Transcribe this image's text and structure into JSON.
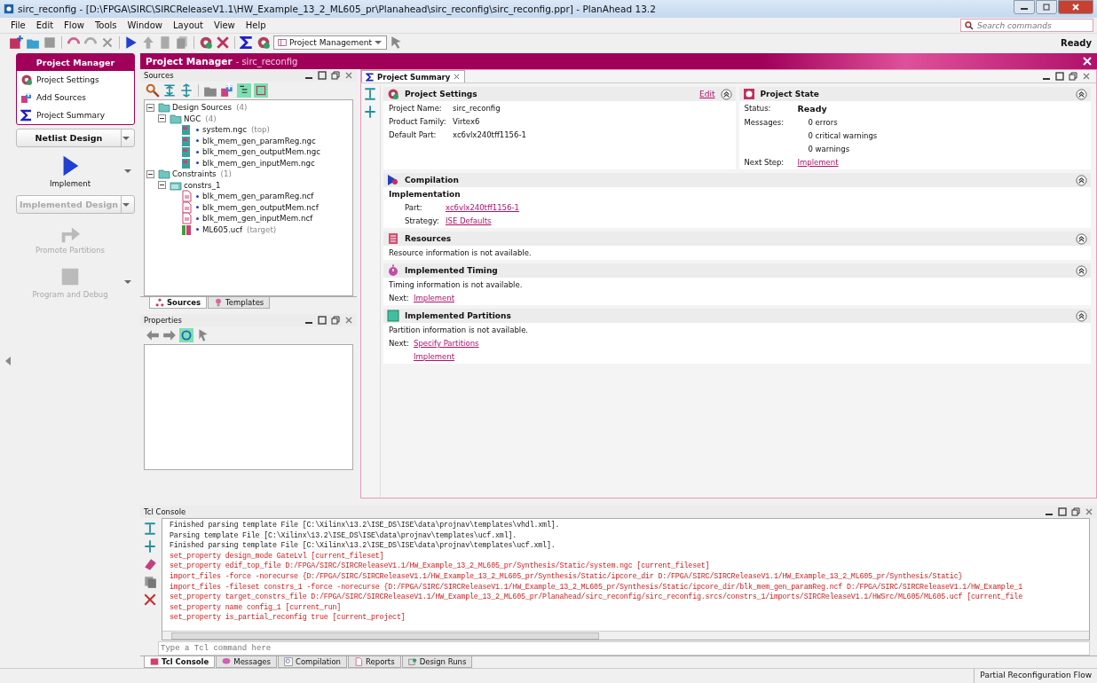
{
  "window": {
    "title": "sirc_reconfig - [D:\\FPGA\\SIRC\\SIRCReleaseV1.1\\HW_Example_13_2_ML605_pr\\Planahead\\sirc_reconfig\\sirc_reconfig.ppr] - PlanAhead  13.2"
  },
  "menu": [
    "File",
    "Edit",
    "Flow",
    "Tools",
    "Window",
    "Layout",
    "View",
    "Help"
  ],
  "search": {
    "placeholder": "Search commands"
  },
  "toolbar": {
    "perspective": "Project Management",
    "status": "Ready"
  },
  "flow_navigator": {
    "header": "Project Manager",
    "items": [
      {
        "label": "Project Settings",
        "kind": "settings"
      },
      {
        "label": "Add Sources",
        "kind": "add"
      },
      {
        "label": "Project Summary",
        "kind": "sigma"
      }
    ],
    "steps": [
      {
        "kind": "dropdown",
        "label": "Netlist Design",
        "disabled": false
      },
      {
        "kind": "action",
        "label": "Implement",
        "disabled": false,
        "menu": true
      },
      {
        "kind": "dropdown",
        "label": "Implemented Design",
        "disabled": true
      },
      {
        "kind": "action",
        "label": "Promote Partitions",
        "disabled": true
      },
      {
        "kind": "action",
        "label": "Program and Debug",
        "disabled": true,
        "menu": true
      }
    ]
  },
  "banner": {
    "title": "Project Manager",
    "subtitle": "- sirc_reconfig"
  },
  "sources": {
    "title": "Sources",
    "tree": [
      {
        "label": "Design Sources",
        "note": "(4)",
        "kind": "folder",
        "expanded": true,
        "children": [
          {
            "label": "NGC",
            "note": "(4)",
            "kind": "folder",
            "expanded": true,
            "children": [
              {
                "label": "system.ngc",
                "note": "(top)",
                "kind": "ngc"
              },
              {
                "label": "blk_mem_gen_paramReg.ngc",
                "kind": "ngc"
              },
              {
                "label": "blk_mem_gen_outputMem.ngc",
                "kind": "ngc"
              },
              {
                "label": "blk_mem_gen_inputMem.ngc",
                "kind": "ngc"
              }
            ]
          }
        ]
      },
      {
        "label": "Constraints",
        "note": "(1)",
        "kind": "folder",
        "expanded": true,
        "children": [
          {
            "label": "constrs_1",
            "kind": "fileset",
            "expanded": true,
            "children": [
              {
                "label": "blk_mem_gen_paramReg.ncf",
                "kind": "ncf"
              },
              {
                "label": "blk_mem_gen_outputMem.ncf",
                "kind": "ncf"
              },
              {
                "label": "blk_mem_gen_inputMem.ncf",
                "kind": "ncf"
              },
              {
                "label": "ML605.ucf",
                "note": "(target)",
                "kind": "ucf"
              }
            ]
          }
        ]
      }
    ],
    "tabs": [
      {
        "label": "Sources",
        "selected": true
      },
      {
        "label": "Templates",
        "selected": false
      }
    ]
  },
  "properties": {
    "title": "Properties"
  },
  "summary": {
    "tab": "Project Summary",
    "settings": {
      "title": "Project Settings",
      "edit": "Edit",
      "rows": [
        {
          "label": "Project Name:",
          "value": "sirc_reconfig"
        },
        {
          "label": "Product Family:",
          "value": "Virtex6"
        },
        {
          "label": "Default Part:",
          "value": "xc6vlx240tff1156-1"
        }
      ]
    },
    "state": {
      "title": "Project State",
      "status_label": "Status:",
      "status": "Ready",
      "messages_label": "Messages:",
      "messages": [
        "0 errors",
        "0 critical warnings",
        "0 warnings"
      ],
      "next_label": "Next Step:",
      "next": "Implement"
    },
    "sections": [
      {
        "title": "Compilation",
        "kind": "compilation",
        "heading": "Implementation",
        "rows": [
          {
            "label": "Part:",
            "links": [
              "xc6vlx240tff1156-1"
            ]
          },
          {
            "label": "Strategy:",
            "links": [
              "ISE Defaults"
            ]
          }
        ]
      },
      {
        "title": "Resources",
        "kind": "resources",
        "text": "Resource information is not available."
      },
      {
        "title": "Implemented Timing",
        "kind": "timing",
        "text": "Timing information is not available.",
        "rows": [
          {
            "label": "Next:",
            "links": [
              "Implement"
            ]
          }
        ]
      },
      {
        "title": "Implemented Partitions",
        "kind": "partitions",
        "text": "Partition information is not available.",
        "rows": [
          {
            "label": "Next:",
            "links": [
              "Specify Partitions",
              "Implement"
            ]
          }
        ]
      }
    ]
  },
  "console": {
    "title": "Tcl Console",
    "placeholder": "Type a Tcl command here",
    "lines": [
      {
        "text": "Finished parsing template File [C:\\Xilinx\\13.2\\ISE_DS\\ISE\\data\\projnav\\templates\\vhdl.xml].",
        "kind": "info"
      },
      {
        "text": "Parsing template File [C:\\Xilinx\\13.2\\ISE_DS\\ISE\\data\\projnav\\templates\\ucf.xml].",
        "kind": "info"
      },
      {
        "text": "Finished parsing template File [C:\\Xilinx\\13.2\\ISE_DS\\ISE\\data\\projnav\\templates\\ucf.xml].",
        "kind": "info"
      },
      {
        "text": "set_property design_mode GateLvl [current_fileset]",
        "kind": "command"
      },
      {
        "text": "set_property edif_top_file D:/FPGA/SIRC/SIRCReleaseV1.1/HW_Example_13_2_ML605_pr/Synthesis/Static/system.ngc [current_fileset]",
        "kind": "command"
      },
      {
        "text": "import_files -force -norecurse {D:/FPGA/SIRC/SIRCReleaseV1.1/HW_Example_13_2_ML605_pr/Synthesis/Static/ipcore_dir D:/FPGA/SIRC/SIRCReleaseV1.1/HW_Example_13_2_ML605_pr/Synthesis/Static}",
        "kind": "command"
      },
      {
        "text": "import_files -fileset constrs_1 -force -norecurse {D:/FPGA/SIRC/SIRCReleaseV1.1/HW_Example_13_2_ML605_pr/Synthesis/Static/ipcore_dir/blk_mem_gen_paramReg.ncf D:/FPGA/SIRC/SIRCReleaseV1.1/HW_Example_1",
        "kind": "command"
      },
      {
        "text": "set_property target_constrs_file D:/FPGA/SIRC/SIRCReleaseV1.1/HW_Example_13_2_ML605_pr/Planahead/sirc_reconfig/sirc_reconfig.srcs/constrs_1/imports/SIRCReleaseV1.1/HWSrc/ML605/ML605.ucf [current_file",
        "kind": "command"
      },
      {
        "text": "set_property name config_1 [current_run]",
        "kind": "command"
      },
      {
        "text": "set_property is_partial_reconfig true [current_project]",
        "kind": "command"
      }
    ],
    "tabs": [
      {
        "label": "Tcl Console",
        "selected": true
      },
      {
        "label": "Messages",
        "selected": false
      },
      {
        "label": "Compilation",
        "selected": false
      },
      {
        "label": "Reports",
        "selected": false
      },
      {
        "label": "Design Runs",
        "selected": false
      }
    ]
  },
  "status_bar": {
    "flow": "Partial Reconfiguration Flow"
  }
}
